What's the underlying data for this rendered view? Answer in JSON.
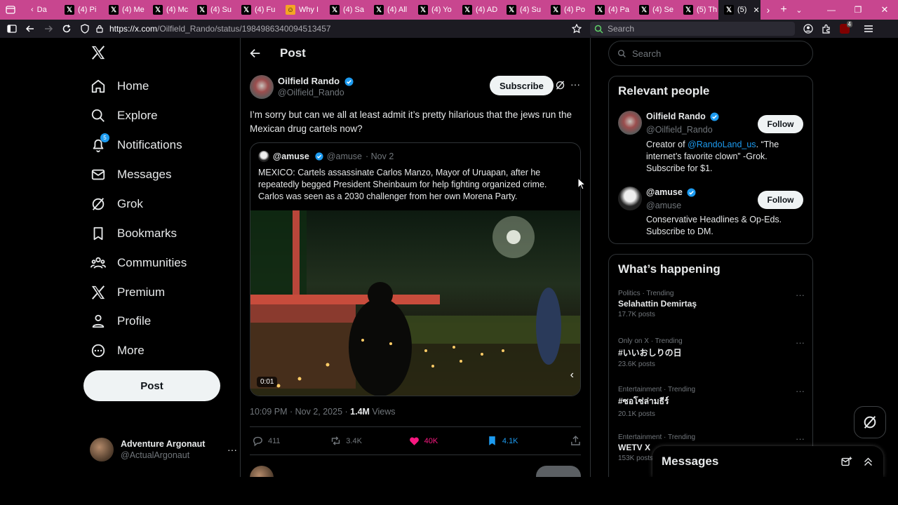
{
  "browser": {
    "tabs": [
      {
        "label": "Da",
        "icon": "tab-list-icon"
      },
      {
        "label": "(4) Pi",
        "icon": "x-logo-icon"
      },
      {
        "label": "(4) Me",
        "icon": "x-logo-icon"
      },
      {
        "label": "(4) Mc",
        "icon": "x-logo-icon"
      },
      {
        "label": "(4) Su",
        "icon": "x-logo-icon"
      },
      {
        "label": "(4) Fu",
        "icon": "x-logo-icon"
      },
      {
        "label": "Why I",
        "icon": "orange-site-icon"
      },
      {
        "label": "(4) Sa",
        "icon": "x-logo-icon"
      },
      {
        "label": "(4) All",
        "icon": "x-logo-icon"
      },
      {
        "label": "(4) Yo",
        "icon": "x-logo-icon"
      },
      {
        "label": "(4) AD",
        "icon": "x-logo-icon"
      },
      {
        "label": "(4) Su",
        "icon": "x-logo-icon"
      },
      {
        "label": "(4) Po",
        "icon": "x-logo-icon"
      },
      {
        "label": "(4) Pa",
        "icon": "x-logo-icon"
      },
      {
        "label": "(4) Se",
        "icon": "x-logo-icon"
      },
      {
        "label": "(5) Th",
        "icon": "x-logo-icon"
      }
    ],
    "active_tab": "(5)",
    "url_host": "https://x.com",
    "url_path": "/Oilfield_Rando/status/1984986340094513457",
    "search_placeholder": "Search",
    "extension_badge": "4"
  },
  "nav": {
    "items": [
      {
        "label": "Home",
        "icon": "home-icon"
      },
      {
        "label": "Explore",
        "icon": "search-icon"
      },
      {
        "label": "Notifications",
        "icon": "bell-icon",
        "badge": "5"
      },
      {
        "label": "Messages",
        "icon": "mail-icon"
      },
      {
        "label": "Grok",
        "icon": "grok-icon"
      },
      {
        "label": "Bookmarks",
        "icon": "bookmark-icon"
      },
      {
        "label": "Communities",
        "icon": "communities-icon"
      },
      {
        "label": "Premium",
        "icon": "x-logo-icon"
      },
      {
        "label": "Profile",
        "icon": "profile-icon"
      },
      {
        "label": "More",
        "icon": "more-circle-icon"
      }
    ],
    "post_button": "Post",
    "account": {
      "name": "Adventure Argonaut",
      "handle": "@ActualArgonaut"
    }
  },
  "main": {
    "header_title": "Post",
    "author": {
      "name": "Oilfield Rando",
      "handle": "@Oilfield_Rando"
    },
    "subscribe_label": "Subscribe",
    "text": "I’m sorry but can we all at least admit it’s pretty hilarious that the jews run the Mexican drug cartels now?",
    "quote": {
      "name": "@amuse",
      "handle": "@amuse",
      "date": "· Nov 2",
      "text": "MEXICO: Cartels assassinate Carlos Manzo, Mayor of Uruapan, after he repeatedly begged President Sheinbaum for help fighting organized crime. Carlos was seen as a 2030 challenger from her own Morena Party.",
      "video_time": "0:01"
    },
    "meta": {
      "time": "10:09 PM · Nov 2, 2025 · ",
      "views_count": "1.4M",
      "views_label": " Views"
    },
    "actions": {
      "replies": "411",
      "reposts": "3.4K",
      "likes": "40K",
      "bookmarks": "4.1K"
    },
    "colors": {
      "like": "#f91880",
      "bookmark": "#1d9bf0",
      "verified": "#1d9bf0"
    }
  },
  "right": {
    "search_placeholder": "Search",
    "relevant_title": "Relevant people",
    "people": [
      {
        "name": "Oilfield Rando",
        "handle": "@Oilfield_Rando",
        "bio_prefix": "Creator of ",
        "bio_link": "@RandoLand_us",
        "bio_suffix": ". “The internet’s favorite clown” -Grok. Subscribe for $1.",
        "follow": "Follow"
      },
      {
        "name": "@amuse",
        "handle": "@amuse",
        "bio": "Conservative Headlines & Op-Eds. Subscribe to DM.",
        "follow": "Follow"
      }
    ],
    "happening_title": "What’s happening",
    "trends": [
      {
        "category": "Politics · Trending",
        "name": "Selahattin Demirtaş",
        "count": "17.7K posts"
      },
      {
        "category": "Only on X · Trending",
        "name": "#いいおしりの日",
        "count": "23.6K posts"
      },
      {
        "category": "Entertainment · Trending",
        "name": "#ซอโซ่ล่ามธีร์",
        "count": "20.1K posts"
      },
      {
        "category": "Entertainment · Trending",
        "name": "WETV X",
        "count": "153K posts"
      }
    ]
  },
  "messages_drawer": {
    "title": "Messages"
  }
}
